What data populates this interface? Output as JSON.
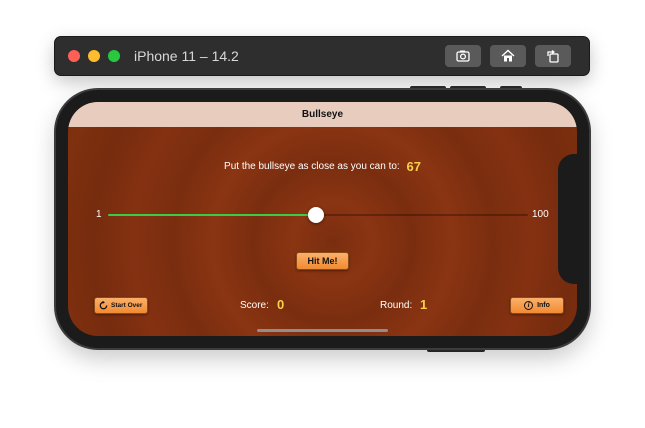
{
  "simulator": {
    "title": "iPhone 11 – 14.2",
    "buttons": [
      {
        "icon": "screenshot-icon"
      },
      {
        "icon": "home-icon"
      },
      {
        "icon": "rotate-icon"
      }
    ]
  },
  "app": {
    "nav_title": "Bullseye",
    "target_label": "Put the bullseye as close as you can to:",
    "target_value": "67",
    "slider": {
      "min_label": "1",
      "max_label": "100",
      "value": 50,
      "min": 1,
      "max": 100
    },
    "hit_button": "Hit Me!",
    "start_over_button": "Start Over",
    "score_label": "Score:",
    "score_value": "0",
    "round_label": "Round:",
    "round_value": "1",
    "info_button": "Info",
    "info_icon_glyph": "i"
  },
  "colors": {
    "nav_bar": "#e8cdbf",
    "background": "#7a2e0f",
    "accent_value": "#f7d14a",
    "slider_fill": "#3bcb47",
    "button_orange": "#f28a33"
  }
}
